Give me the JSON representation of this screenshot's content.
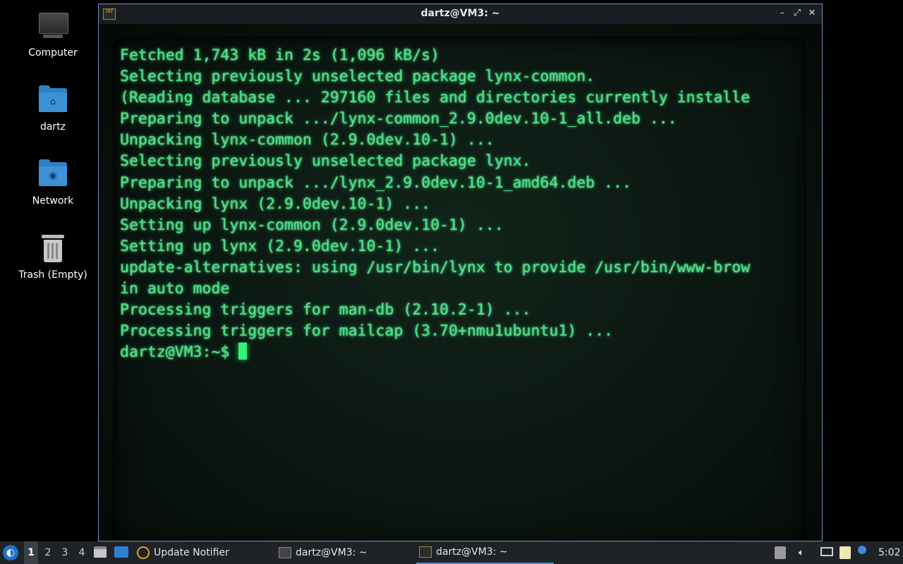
{
  "desktop": {
    "icons": [
      {
        "label": "Computer",
        "icon": "computer-icon"
      },
      {
        "label": "dartz",
        "icon": "home-folder-icon"
      },
      {
        "label": "Network",
        "icon": "network-folder-icon"
      },
      {
        "label": "Trash (Empty)",
        "icon": "trash-icon"
      }
    ]
  },
  "window": {
    "title": "dartz@VM3: ~",
    "app_icon_text": "CRT",
    "buttons": {
      "minimize": "–",
      "maximize": "⤢",
      "close": "✕"
    }
  },
  "terminal": {
    "lines": [
      "Fetched 1,743 kB in 2s (1,096 kB/s)",
      "Selecting previously unselected package lynx-common.",
      "(Reading database ... 297160 files and directories currently installe",
      "Preparing to unpack .../lynx-common_2.9.0dev.10-1_all.deb ...",
      "Unpacking lynx-common (2.9.0dev.10-1) ...",
      "Selecting previously unselected package lynx.",
      "Preparing to unpack .../lynx_2.9.0dev.10-1_amd64.deb ...",
      "Unpacking lynx (2.9.0dev.10-1) ...",
      "Setting up lynx-common (2.9.0dev.10-1) ...",
      "Setting up lynx (2.9.0dev.10-1) ...",
      "update-alternatives: using /usr/bin/lynx to provide /usr/bin/www-brow",
      "in auto mode",
      "Processing triggers for man-db (2.10.2-1) ...",
      "Processing triggers for mailcap (3.70+nmu1ubuntu1) ..."
    ],
    "prompt": "dartz@VM3:~$ ",
    "text_color": "#4fe08a"
  },
  "taskbar": {
    "workspaces": [
      "1",
      "2",
      "3",
      "4"
    ],
    "active_workspace": "1",
    "tasks": [
      {
        "label": "Update Notifier",
        "icon": "update-notifier-icon"
      },
      {
        "label": "dartz@VM3: ~",
        "icon": "terminal-icon"
      },
      {
        "label": "dartz@VM3: ~",
        "icon": "crt-terminal-icon",
        "active": true
      }
    ],
    "clock": "5:02"
  },
  "colors": {
    "taskbar_bg": "#1f2327",
    "accent": "#4f8fd8",
    "folder": "#3d92d6"
  }
}
